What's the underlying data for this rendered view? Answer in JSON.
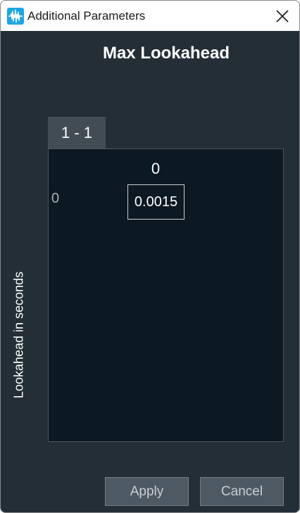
{
  "window": {
    "title": "Additional Parameters"
  },
  "dialog": {
    "heading": "Max Lookahead",
    "tab_label": "1 - 1",
    "column_header": "0",
    "row_header": "0",
    "cell_value": "0.0015",
    "y_axis_label": "Lookahead in seconds"
  },
  "buttons": {
    "apply": "Apply",
    "cancel": "Cancel"
  },
  "colors": {
    "background": "#232e37",
    "grid_background": "#0c1922",
    "tab": "#414c55",
    "button": "#4d5963",
    "app_icon": "#1aa6e6"
  },
  "icons": {
    "app": "waveform-icon",
    "close": "close-icon"
  }
}
